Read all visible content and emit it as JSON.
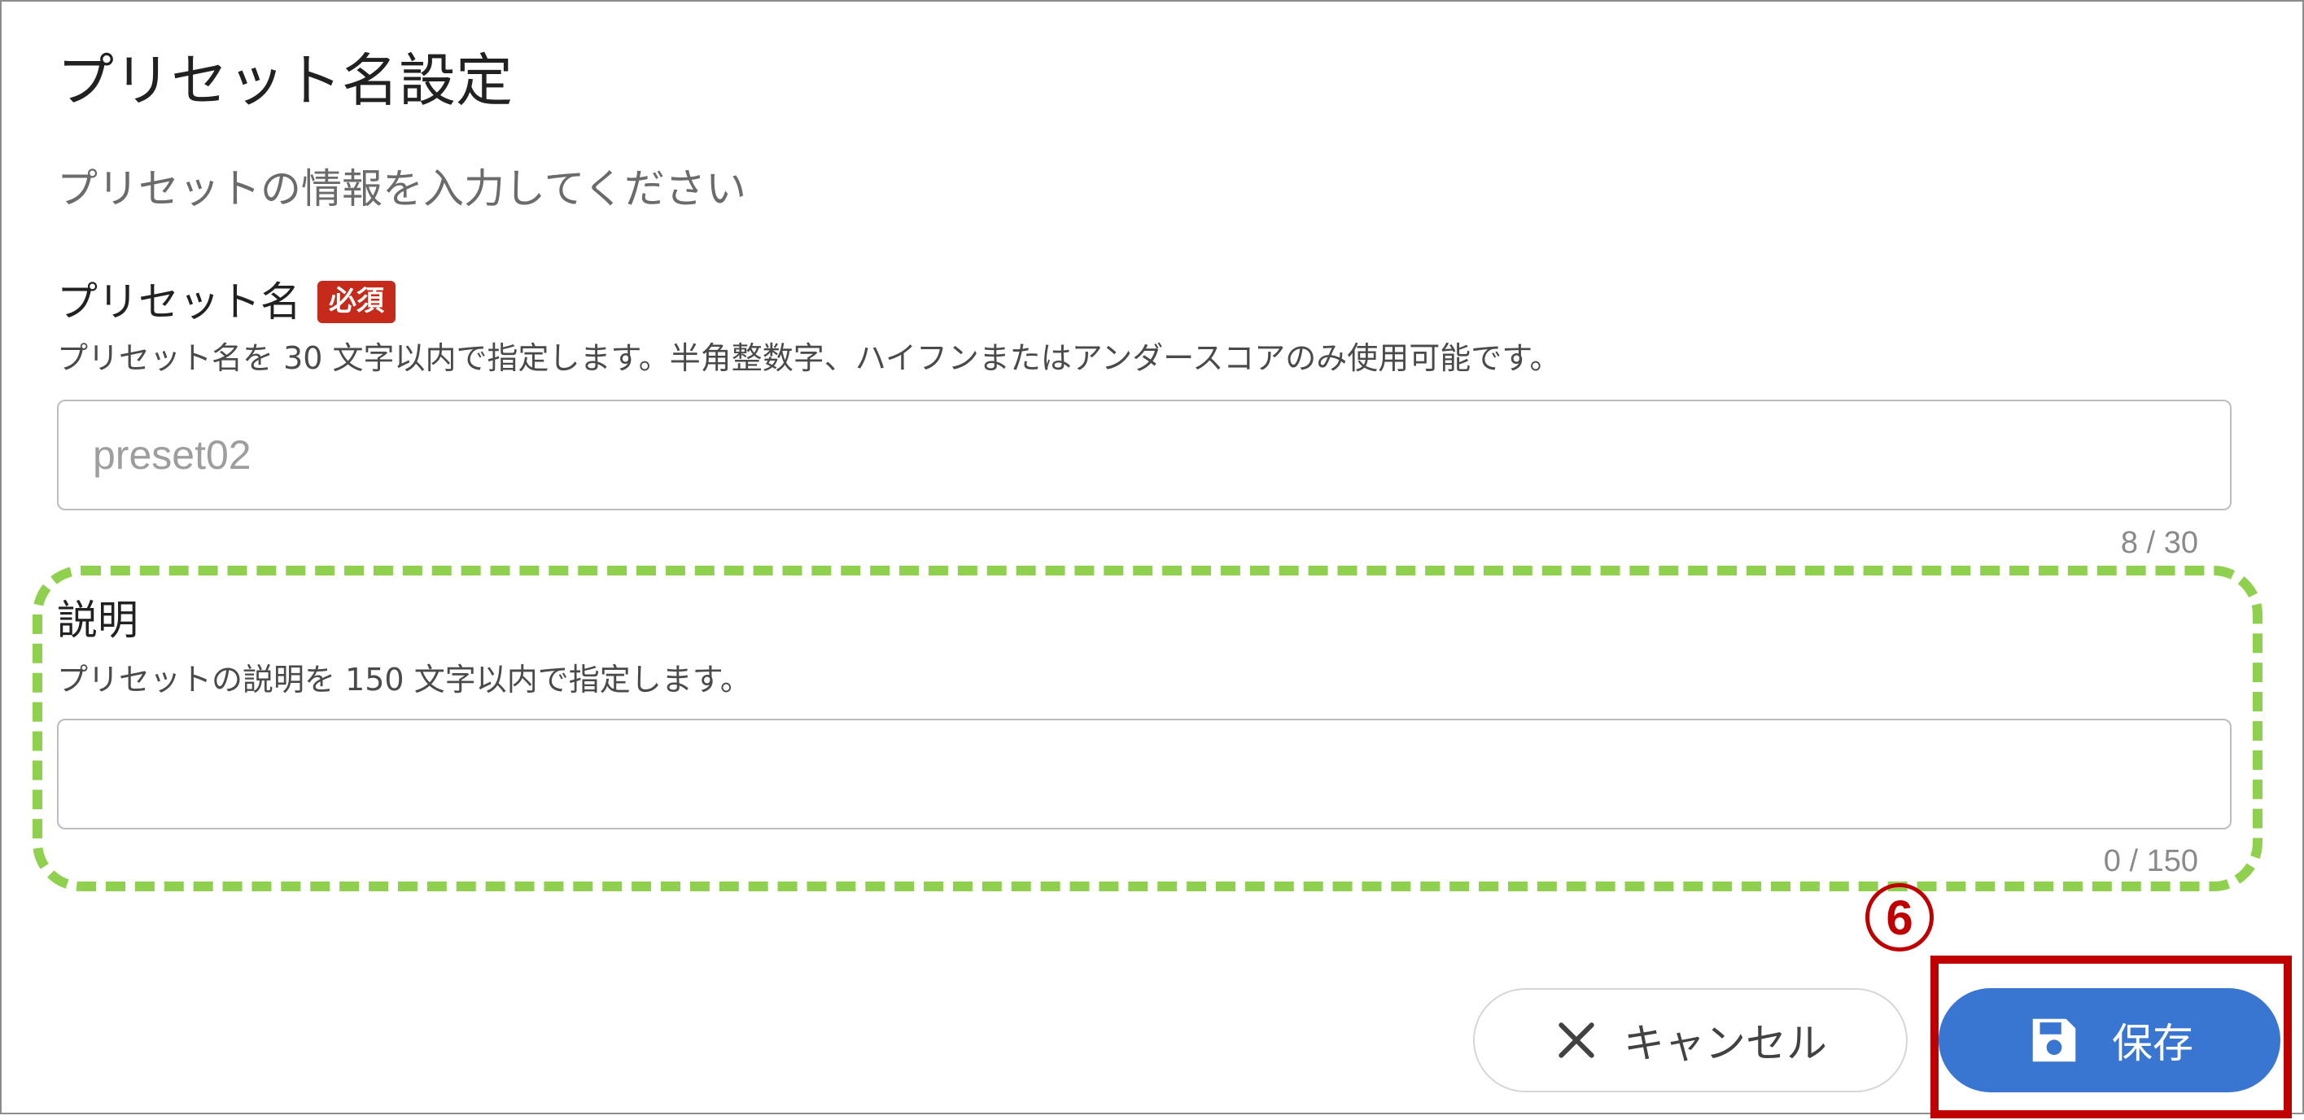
{
  "dialog": {
    "title": "プリセット名設定",
    "subtitle": "プリセットの情報を入力してください"
  },
  "preset_name": {
    "label": "プリセット名",
    "required_badge": "必須",
    "help": "プリセット名を 30 文字以内で指定します。半角整数字、ハイフンまたはアンダースコアのみ使用可能です。",
    "value": "preset02",
    "counter": "8 / 30"
  },
  "description": {
    "label": "説明",
    "help": "プリセットの説明を 150 文字以内で指定します。",
    "value": "",
    "counter": "0 / 150"
  },
  "annotation": {
    "step_number": "6",
    "highlight_color": "#c00000",
    "dash_color": "#8fd14f"
  },
  "actions": {
    "cancel_label": "キャンセル",
    "cancel_icon": "close-icon",
    "save_label": "保存",
    "save_icon": "floppy-disk-icon",
    "save_color": "#3976d2"
  }
}
